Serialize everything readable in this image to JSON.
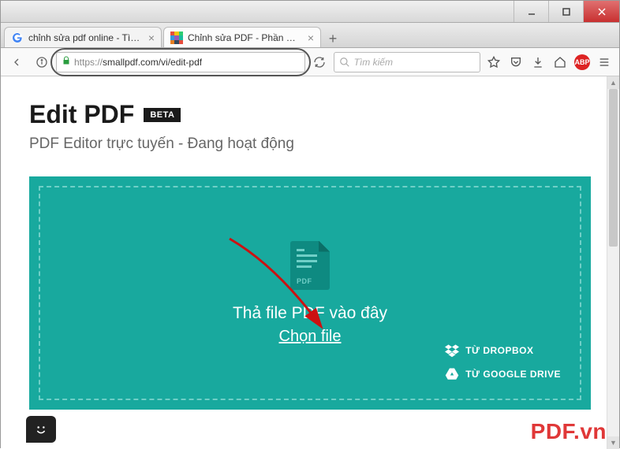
{
  "window": {
    "tabs": [
      {
        "label": "chỉnh sửa pdf online - Tìm vớ",
        "favicon": "google"
      },
      {
        "label": "Chỉnh sửa PDF - Phần mềm c",
        "favicon": "smallpdf"
      }
    ]
  },
  "navbar": {
    "url_protocol": "https://",
    "url_rest": "smallpdf.com/vi/edit-pdf",
    "search_placeholder": "Tìm kiếm",
    "abp_label": "ABP"
  },
  "page": {
    "title": "Edit PDF",
    "badge": "BETA",
    "subtitle": "PDF Editor trực tuyến - Đang hoạt động",
    "drop_text": "Thả file PDF vào đây",
    "choose_file": "Chọn file",
    "pdf_icon_label": "PDF",
    "from_dropbox": "TỪ DROPBOX",
    "from_gdrive": "TỪ GOOGLE DRIVE"
  },
  "watermark": "PDF.vn",
  "colors": {
    "accent": "#18a99e",
    "accent_dark": "#0e8a81",
    "watermark": "#e03838"
  }
}
